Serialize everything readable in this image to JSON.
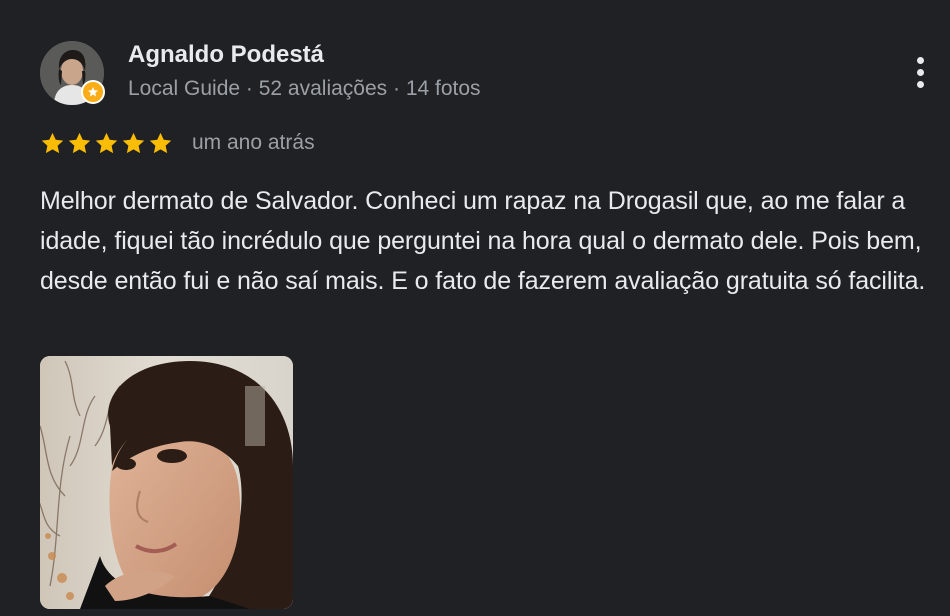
{
  "review": {
    "author_name": "Agnaldo Podestá",
    "author_meta": "Local Guide · 52 avaliações · 14 fotos",
    "rating": 5,
    "rating_max": 5,
    "date": "um ano atrás",
    "text": "Melhor dermato de Salvador. Conheci um rapaz na Drogasil que, ao me falar a idade, fiquei tão incrédulo que perguntei na hora qual o dermato dele. Pois bem, desde então fui e não saí mais. E o fato de fazerem avaliação gratuita só facilita.",
    "more_options_icon": "three-dots-vertical-icon",
    "badge_icon": "local-guide-star-icon"
  },
  "colors": {
    "background": "#202124",
    "primary_text": "#e8eaed",
    "secondary_text": "#9aa0a6",
    "star": "#fbbc04",
    "badge": "#fbad18"
  }
}
